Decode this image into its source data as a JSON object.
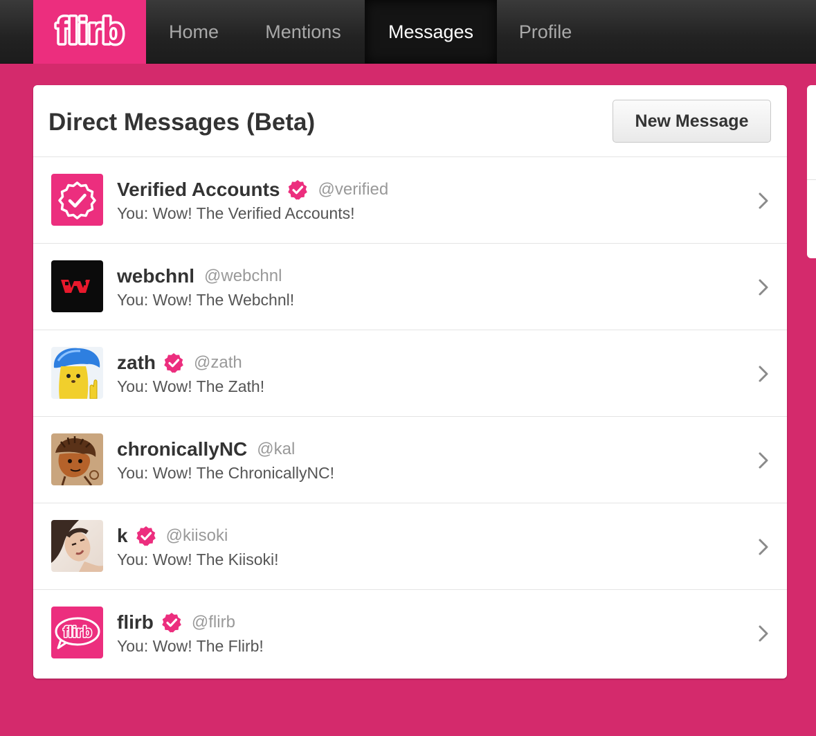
{
  "nav": {
    "logo_text": "flirb",
    "items": [
      {
        "label": "Home"
      },
      {
        "label": "Mentions"
      },
      {
        "label": "Messages"
      },
      {
        "label": "Profile"
      }
    ],
    "active": "Messages"
  },
  "panel": {
    "title": "Direct Messages (Beta)",
    "new_message_label": "New Message"
  },
  "conversations": [
    {
      "name": "Verified Accounts",
      "verified": true,
      "handle": "@verified",
      "preview": "You: Wow! The Verified Accounts!",
      "avatar": "verified-badge-logo"
    },
    {
      "name": "webchnl",
      "verified": false,
      "handle": "@webchnl",
      "preview": "You: Wow! The Webchnl!",
      "avatar": "webchnl-logo"
    },
    {
      "name": "zath",
      "verified": true,
      "handle": "@zath",
      "preview": "You: Wow! The Zath!",
      "avatar": "cartoon-character"
    },
    {
      "name": "chronicallyNC",
      "verified": false,
      "handle": "@kal",
      "preview": "You: Wow! The ChronicallyNC!",
      "avatar": "drawn-character"
    },
    {
      "name": "k",
      "verified": true,
      "handle": "@kiisoki",
      "preview": "You: Wow! The Kiisoki!",
      "avatar": "photo"
    },
    {
      "name": "flirb",
      "verified": true,
      "handle": "@flirb",
      "preview": "You: Wow! The Flirb!",
      "avatar": "flirb-logo"
    }
  ],
  "colors": {
    "brand_pink": "#ec2e7e",
    "background": "#d42a6c",
    "topbar": "#222222"
  }
}
